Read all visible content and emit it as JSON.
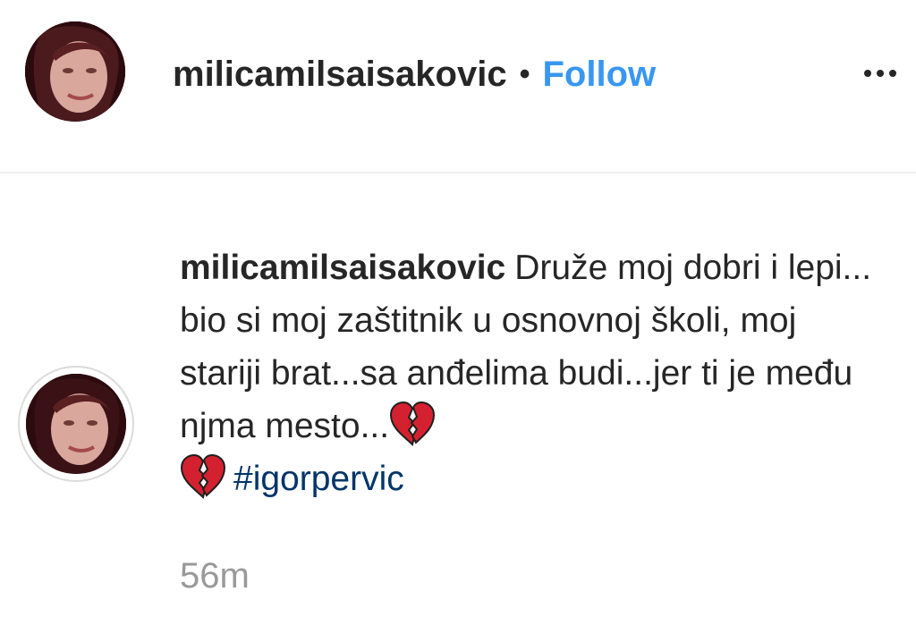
{
  "post": {
    "username": "milicamilsaisakovic",
    "separator": "•",
    "follow_label": "Follow",
    "more_icon": "more-options-icon"
  },
  "comment": {
    "username": "milicamilsaisakovic",
    "text": "Druže moj dobri i lepi... bio si moj zaštitnik u osnovnoj školi, moj stariji brat...sa anđelima budi...jer ti je među njma mesto...",
    "emoji_icons": [
      "broken-heart-icon",
      "broken-heart-icon"
    ],
    "hashtag": "#igorpervic",
    "timestamp": "56m"
  },
  "colors": {
    "follow": "#3897f0",
    "hashtag": "#003569",
    "timestamp": "#999999",
    "text": "#262626",
    "divider": "#efefef"
  }
}
